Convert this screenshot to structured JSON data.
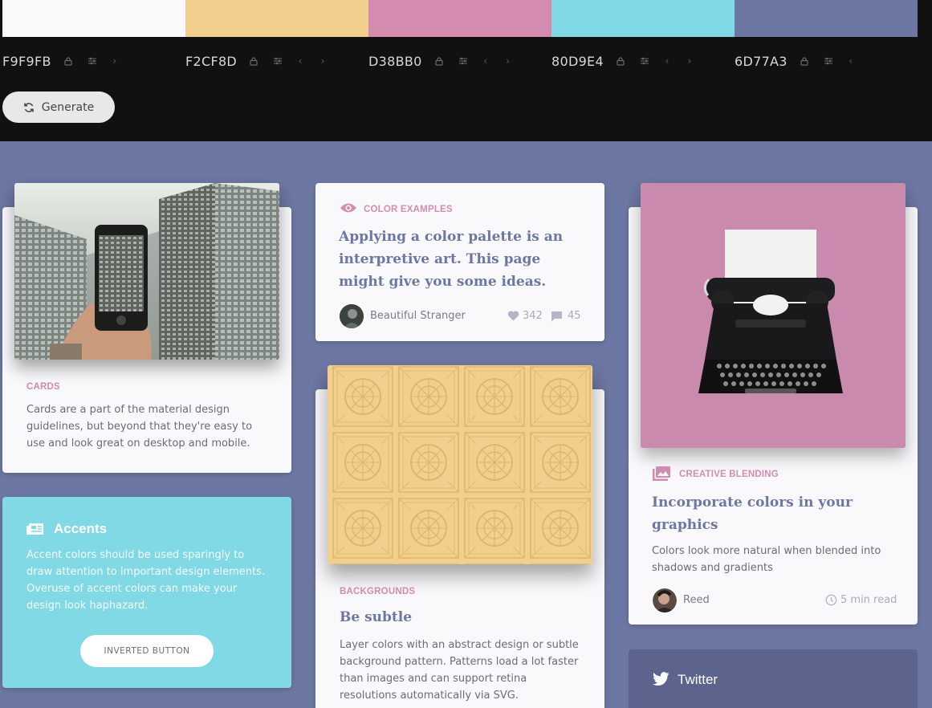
{
  "palette": [
    {
      "hex": "F9F9FB",
      "color": "#f9f9fb",
      "has_prev": false,
      "has_next": true
    },
    {
      "hex": "F2CF8D",
      "color": "#f2cf8d",
      "has_prev": true,
      "has_next": true
    },
    {
      "hex": "D38BB0",
      "color": "#d38bb0",
      "has_prev": true,
      "has_next": true
    },
    {
      "hex": "80D9E4",
      "color": "#80d9e4",
      "has_prev": true,
      "has_next": true
    },
    {
      "hex": "6D77A3",
      "color": "#6d77a3",
      "has_prev": true,
      "has_next": false
    }
  ],
  "generate_label": "Generate",
  "cards_card": {
    "eyebrow": "CARDS",
    "text": "Cards are a part of the material design guidelines, but beyond that they're easy to use and look great on desktop and mobile."
  },
  "accents_card": {
    "title": "Accents",
    "text": "Accent colors should be used sparingly to draw attention to important design elements. Overuse of accent colors can make your design look haphazard.",
    "button_label": "INVERTED BUTTON"
  },
  "examples_card": {
    "eyebrow": "COLOR EXAMPLES",
    "title": "Applying a color palette is an interpretive art. This page might give you some ideas.",
    "author": "Beautiful Stranger",
    "likes": "342",
    "comments": "45"
  },
  "backgrounds_card": {
    "eyebrow": "BACKGROUNDS",
    "title": "Be subtle",
    "text": "Layer colors with an abstract design or subtle background pattern. Patterns load a lot faster than images and can support retina resolutions automatically via SVG."
  },
  "blending_card": {
    "eyebrow": "CREATIVE BLENDING",
    "title": "Incorporate colors in your graphics",
    "text": "Colors look more natural when blended into shadows and gradients",
    "author": "Reed",
    "read_time": "5 min read"
  },
  "twitter_card": {
    "title": "Twitter"
  },
  "colors": {
    "accent_pink": "#d38bb0",
    "accent_cyan": "#80d9e4",
    "accent_yellow": "#f2cf8d",
    "background": "#6d77a3",
    "card": "#f9f9fb"
  },
  "icons": [
    "lock-icon",
    "sliders-icon",
    "chevron-left-icon",
    "chevron-right-icon",
    "refresh-icon",
    "eye-icon",
    "heart-icon",
    "comment-icon",
    "newspaper-icon",
    "image-icon",
    "clock-icon",
    "twitter-icon"
  ]
}
